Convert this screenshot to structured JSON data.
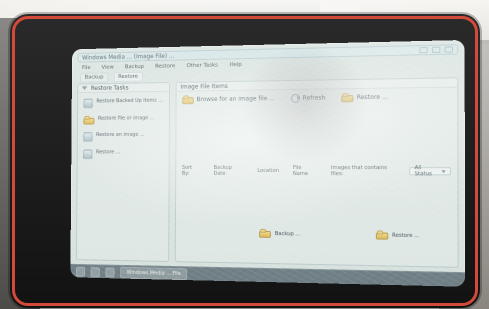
{
  "ui": {
    "titlebar": {
      "text": "Windows Media ... (Image File) ...",
      "controls": {
        "minimize_icon": "minimize-icon",
        "maximize_icon": "maximize-icon",
        "close_icon": "close-icon"
      }
    },
    "menubar": {
      "items": [
        "File",
        "View",
        "Backup",
        "Restore",
        "Other Tasks",
        "Help"
      ]
    },
    "tabs": [
      {
        "label": "Backup"
      },
      {
        "label": "Restore"
      }
    ],
    "left_panel": {
      "header": "Restore Tasks",
      "items": [
        {
          "icon": "backup-icon",
          "text": "Restore Backed Up Items ..."
        },
        {
          "icon": "folder-icon",
          "text": "Restore file or image ..."
        },
        {
          "icon": "restore-icon",
          "text": "Restore an image ..."
        },
        {
          "icon": "restore-icon",
          "text": "Restore ..."
        }
      ]
    },
    "right_panel": {
      "header": "Image File Items",
      "actions": [
        {
          "icon": "folder-icon",
          "label": "Browse for an image file ..."
        },
        {
          "icon": "refresh-icon",
          "label": "Refresh"
        },
        {
          "icon": "folder-icon",
          "label": "Restore ..."
        }
      ],
      "sort": {
        "label": "Sort By:",
        "options": [
          "Backup Date",
          "Location",
          "File Name"
        ],
        "filter_label": "Images that contains files:",
        "filter_value": "All Status"
      },
      "items": [
        {
          "icon": "folder-icon",
          "label": "Backup ..."
        },
        {
          "icon": "folder-icon",
          "label": "Restore ..."
        }
      ]
    },
    "taskbar": {
      "window_label": "Windows Media ... File"
    }
  },
  "colors": {
    "bezel_red": "#d34a3a",
    "screen_tint": "#d7e2de"
  }
}
